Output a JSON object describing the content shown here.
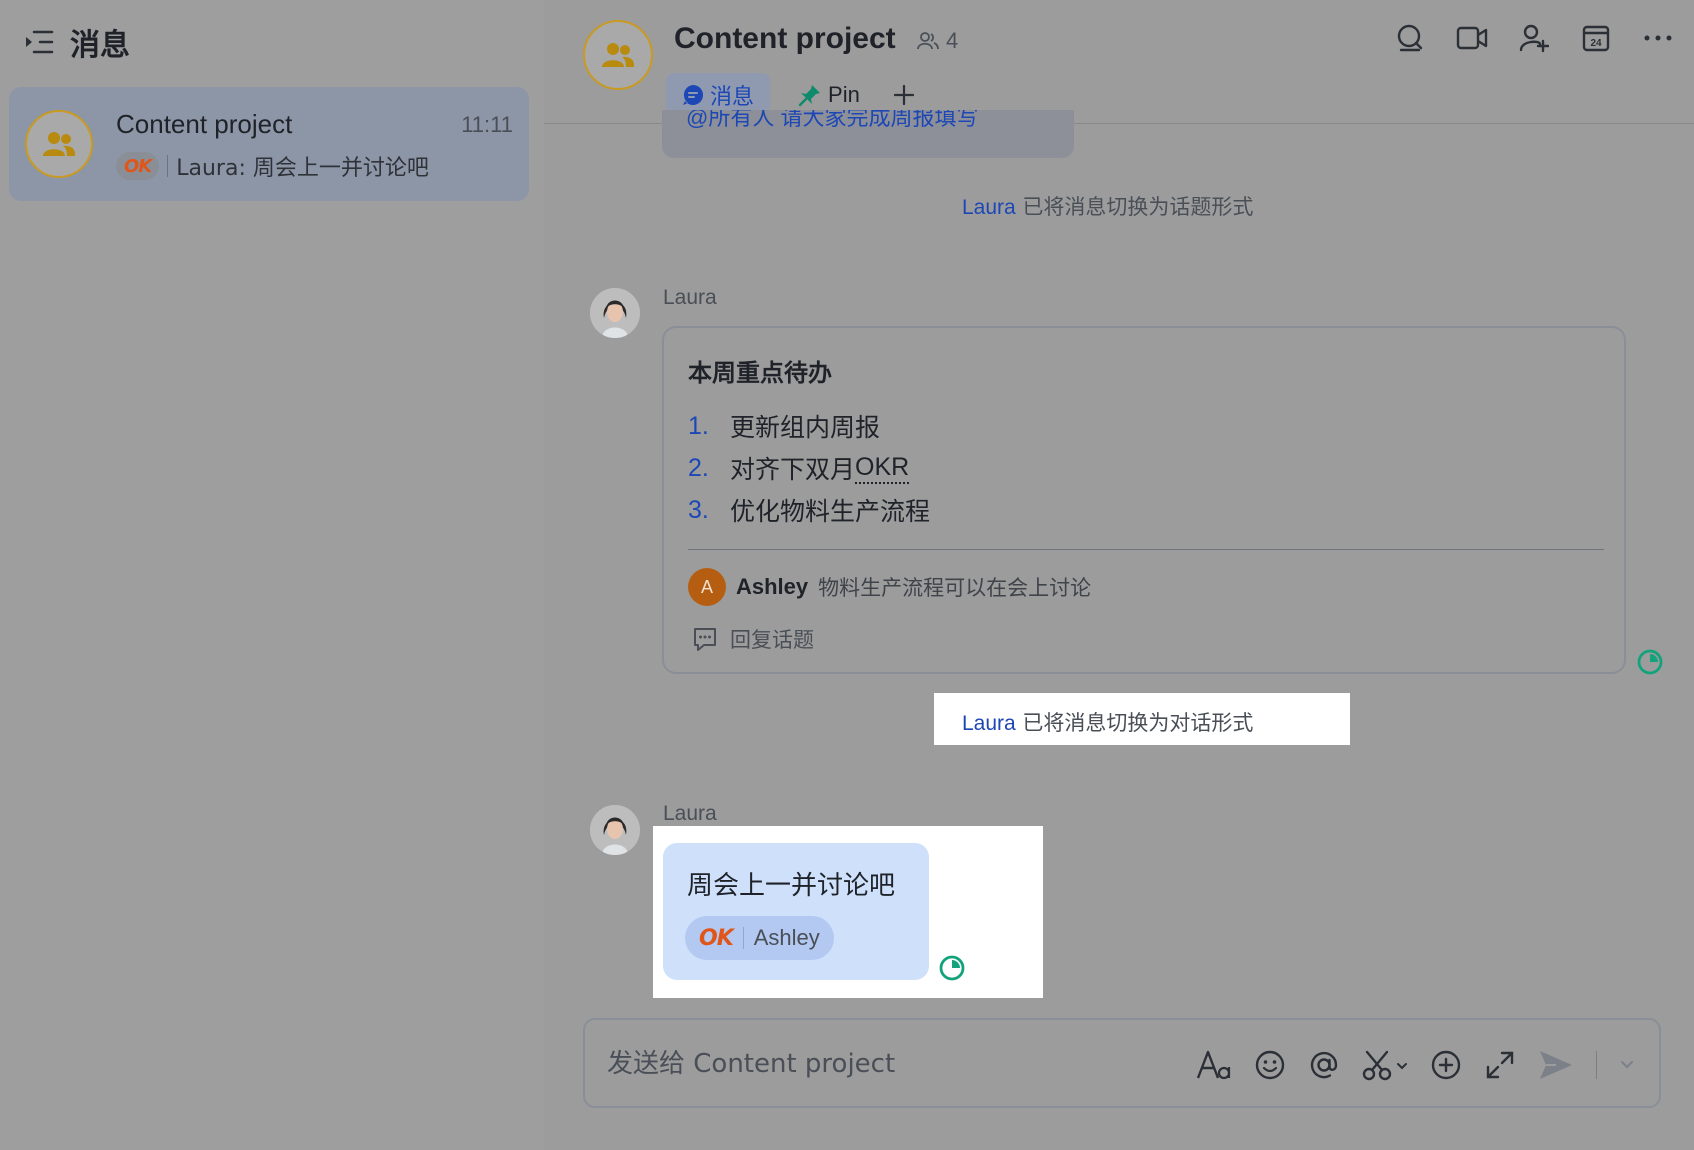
{
  "sidebar": {
    "title": "消息",
    "chat": {
      "name": "Content project",
      "time": "11:11",
      "preview_badge": "OK",
      "preview": "Laura: 周会上一并讨论吧"
    }
  },
  "header": {
    "title": "Content project",
    "member_count": "4",
    "tabs": {
      "messages": "消息",
      "pin": "Pin"
    }
  },
  "messages": {
    "clipped_text": "@所有人 请大家完成周报填写",
    "system1": {
      "who": "Laura",
      "text": " 已将消息切换为话题形式"
    },
    "topic": {
      "sender": "Laura",
      "title": "本周重点待办",
      "items": [
        {
          "num": "1.",
          "text": "更新组内周报"
        },
        {
          "num": "2.",
          "text": "对齐下双月 ",
          "term": "OKR"
        },
        {
          "num": "3.",
          "text": "优化物料生产流程"
        }
      ],
      "reply": {
        "initial": "A",
        "name": "Ashley",
        "text": "物料生产流程可以在会上讨论"
      },
      "reply_topic": "回复话题"
    },
    "system2": {
      "who": "Laura",
      "text": " 已将消息切换为对话形式"
    },
    "message": {
      "sender": "Laura",
      "text": "周会上一并讨论吧",
      "reaction": {
        "emoji": "OK",
        "name": "Ashley"
      }
    }
  },
  "composer": {
    "placeholder": "发送给 Content project"
  },
  "colors": {
    "accent": "#1c47b5",
    "status": "#13a37c",
    "bubble": "#cfe0fb",
    "group_avatar_ring": "#c99a22"
  }
}
